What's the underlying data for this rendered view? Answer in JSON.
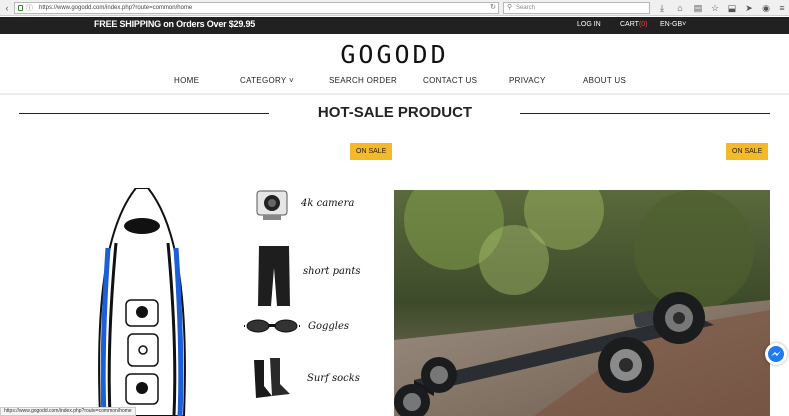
{
  "browser": {
    "url": "https://www.gogodd.com/index.php?route=common/home",
    "search_placeholder": "Search",
    "status_url": "https://www.gogodd.com/index.php?route=common/home"
  },
  "topbar": {
    "shipping": "FREE SHIPPING on Orders Over $29.95",
    "login": "LOG IN",
    "cart_label": "CART",
    "cart_count": "(0)",
    "language": "EN-GB"
  },
  "logo": {
    "text": "GOGODD"
  },
  "nav": {
    "items": [
      {
        "label": "HOME"
      },
      {
        "label": "CATEGORY"
      },
      {
        "label": "SEARCH ORDER"
      },
      {
        "label": "CONTACT US"
      },
      {
        "label": "PRIVACY"
      },
      {
        "label": "ABOUT US"
      }
    ]
  },
  "section": {
    "title": "HOT-SALE PRODUCT"
  },
  "products": [
    {
      "badge": "ON SALE",
      "accessories": [
        {
          "label": "4k camera"
        },
        {
          "label": "short pants"
        },
        {
          "label": "Goggles"
        },
        {
          "label": "Surf socks"
        }
      ]
    },
    {
      "badge": "ON SALE"
    }
  ],
  "colors": {
    "topbar": "#212121",
    "badge": "#f4b829",
    "cart_count": "#e44444"
  }
}
